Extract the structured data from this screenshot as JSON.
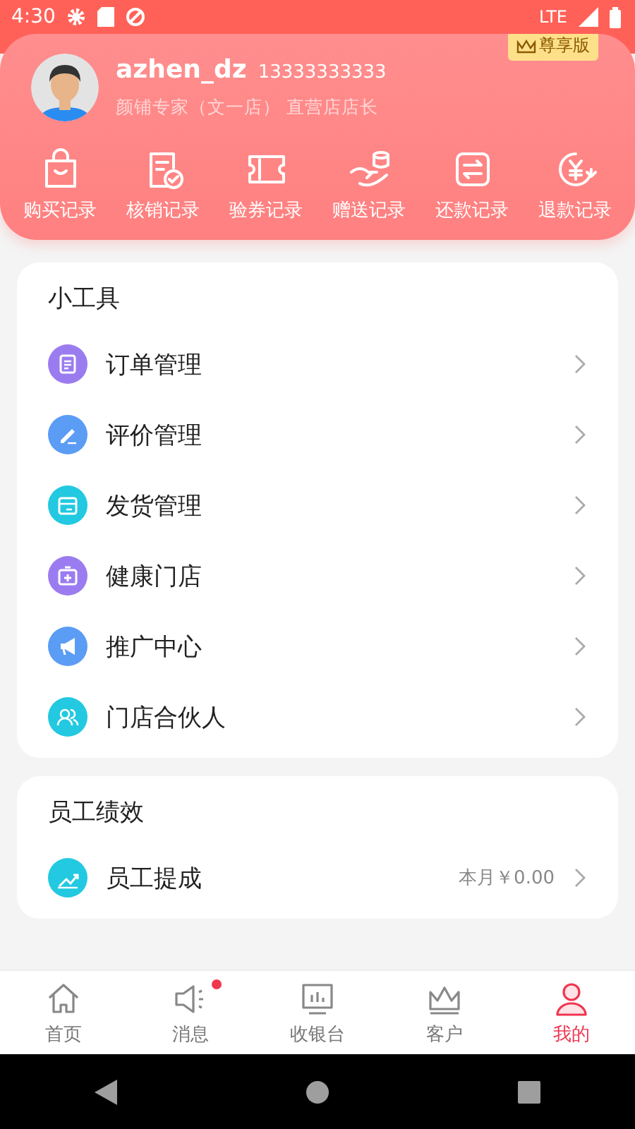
{
  "status_bar": {
    "time": "4:30",
    "network": "LTE"
  },
  "profile": {
    "name": "azhen_dz",
    "phone": "13333333333",
    "role": "颜铺专家（文一店） 直营店店长",
    "badge": "尊享版"
  },
  "shortcuts": [
    {
      "label": "购买记录"
    },
    {
      "label": "核销记录"
    },
    {
      "label": "验券记录"
    },
    {
      "label": "赠送记录"
    },
    {
      "label": "还款记录"
    },
    {
      "label": "退款记录"
    }
  ],
  "tools": {
    "title": "小工具",
    "items": [
      {
        "label": "订单管理",
        "color": "#9b7cf0"
      },
      {
        "label": "评价管理",
        "color": "#5b9cf5"
      },
      {
        "label": "发货管理",
        "color": "#22c9e0"
      },
      {
        "label": "健康门店",
        "color": "#9b7cf0"
      },
      {
        "label": "推广中心",
        "color": "#5b9cf5"
      },
      {
        "label": "门店合伙人",
        "color": "#22c9e0"
      }
    ]
  },
  "performance": {
    "title": "员工绩效",
    "items": [
      {
        "label": "员工提成",
        "color": "#22c9e0",
        "value": "本月￥0.00"
      }
    ]
  },
  "tab_bar": [
    {
      "label": "首页",
      "selected": false,
      "dot": false
    },
    {
      "label": "消息",
      "selected": false,
      "dot": true
    },
    {
      "label": "收银台",
      "selected": false,
      "dot": false
    },
    {
      "label": "客户",
      "selected": false,
      "dot": false
    },
    {
      "label": "我的",
      "selected": true,
      "dot": false
    }
  ]
}
